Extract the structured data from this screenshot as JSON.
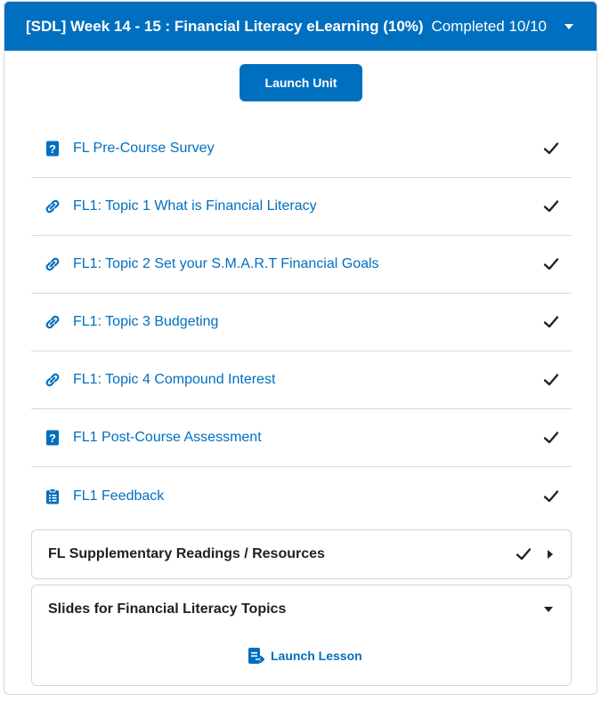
{
  "unit": {
    "title": "[SDL] Week 14 - 15 : Financial Literacy eLearning (10%)",
    "status": "Completed 10/10",
    "launch_label": "Launch Unit"
  },
  "items": [
    {
      "label": "FL Pre-Course Survey",
      "icon": "survey-icon"
    },
    {
      "label": "FL1: Topic 1 What is Financial Literacy",
      "icon": "link-icon"
    },
    {
      "label": "FL1: Topic 2 Set your S.M.A.R.T Financial Goals",
      "icon": "link-icon"
    },
    {
      "label": "FL1: Topic 3 Budgeting",
      "icon": "link-icon"
    },
    {
      "label": "FL1: Topic 4 Compound Interest",
      "icon": "link-icon"
    },
    {
      "label": "FL1 Post-Course Assessment",
      "icon": "quiz-icon"
    },
    {
      "label": "FL1 Feedback",
      "icon": "feedback-icon"
    }
  ],
  "sub_units": [
    {
      "title": "FL Supplementary Readings / Resources"
    },
    {
      "title": "Slides for Financial Literacy Topics",
      "launch_label": "Launch Lesson"
    }
  ],
  "colors": {
    "accent": "#006fbf",
    "text": "#202122",
    "divider": "#d3d9e3"
  }
}
